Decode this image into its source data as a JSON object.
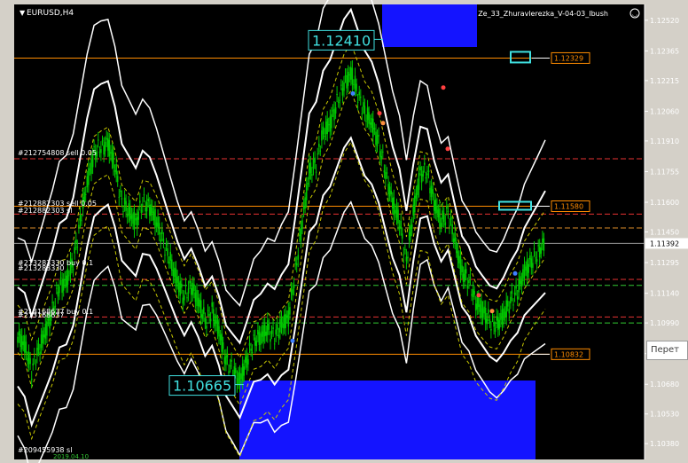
{
  "window": {
    "symbol_label": "EURUSD,H4",
    "indicator_label": "Ze_33_Zhuravlerezka_V-04-03_Ibush"
  },
  "colors": {
    "background": "#000000",
    "candles": "#00c800",
    "envelope": "#ffffff",
    "dashed_yellow": "#c8c800",
    "accent_orange": "#ff8c00",
    "blue_zone": "#1414ff",
    "cyan_label": "#40e0e0"
  },
  "chart_data": {
    "type": "line",
    "ylim": [
      1.103,
      1.126
    ],
    "grid": false,
    "y_ticks": [
      "1.12520",
      "1.12365",
      "1.12215",
      "1.12060",
      "1.11910",
      "1.11755",
      "1.11600",
      "1.11450",
      "1.11295",
      "1.11140",
      "1.10990",
      "1.10835",
      "1.10680",
      "1.10530",
      "1.10380"
    ],
    "current_price": "1.11392",
    "price_tags": [
      {
        "label": "1.12329",
        "value": 1.12329
      },
      {
        "label": "1.11580",
        "value": 1.1158
      },
      {
        "label": "1.10832",
        "value": 1.10832
      }
    ],
    "high_label": "1.12410",
    "low_label": "1.10665",
    "order_labels": [
      "#212754808 sell 0.05",
      "#212882303 sell 0.05",
      "#212882303 sl",
      "#213283330 buy 0.1",
      "#213283330",
      "#213168637 buy 0.1",
      "#213168637",
      "#209455938 sl"
    ],
    "bottom_label": "2019.04.10",
    "series": [
      {
        "values": [
          1.1092,
          1.1088,
          1.1075,
          1.1085,
          1.1095,
          1.1105,
          1.1118,
          1.112,
          1.113,
          1.115,
          1.117,
          1.1185,
          1.1188,
          1.119,
          1.1178,
          1.116,
          1.1155,
          1.115,
          1.116,
          1.1158,
          1.115,
          1.114,
          1.113,
          1.112,
          1.1112,
          1.1118,
          1.111,
          1.11,
          1.1105,
          1.1095,
          1.108,
          1.1075,
          1.107,
          1.108,
          1.109,
          1.1092,
          1.1096,
          1.1092,
          1.1098,
          1.1102,
          1.1125,
          1.115,
          1.1175,
          1.118,
          1.1195,
          1.12,
          1.121,
          1.122,
          1.1225,
          1.1215,
          1.1205,
          1.12,
          1.119,
          1.1175,
          1.116,
          1.115,
          1.113,
          1.1155,
          1.1175,
          1.1175,
          1.116,
          1.115,
          1.1155,
          1.114,
          1.1125,
          1.112,
          1.111,
          1.1105,
          1.11,
          1.1098,
          1.1103,
          1.111,
          1.1115,
          1.1125,
          1.113,
          1.1135,
          1.114
        ]
      }
    ]
  },
  "sidebar": {
    "button_label": "Перет"
  }
}
